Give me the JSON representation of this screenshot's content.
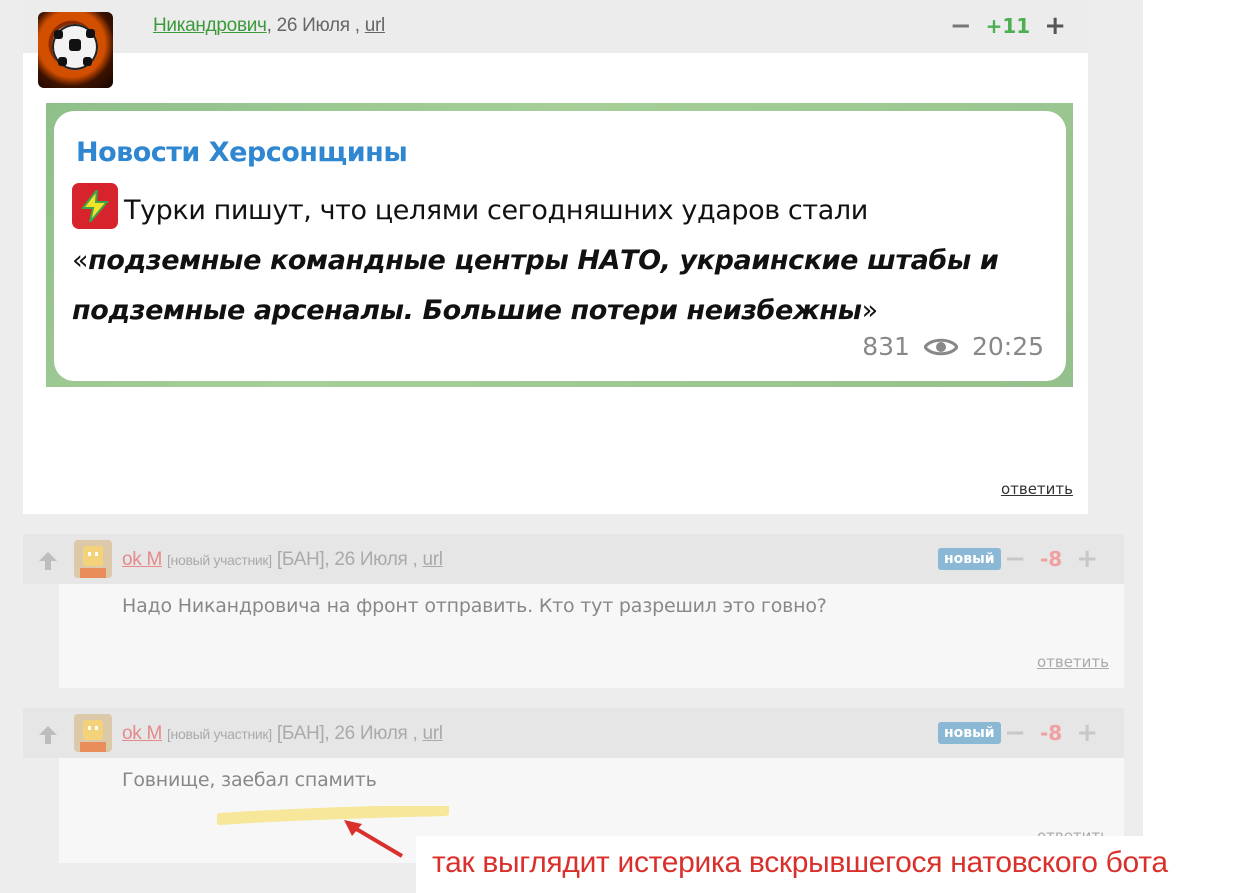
{
  "main_comment": {
    "author": "Никандрович",
    "date": ", 26 Июля ,",
    "link": "url",
    "score": "+11",
    "vote_minus": "−",
    "vote_plus": "+",
    "reply": "ответить",
    "telegram_post": {
      "channel": "Новости Херсонщины",
      "text_plain": "Турки пишут, что целями сегодняшних ударов стали «",
      "text_emphasis": "подземные командные центры НАТО, украинские штабы и подземные арсеналы. Большие потери неизбежны",
      "text_close": "»",
      "views": "831",
      "time": "20:25"
    }
  },
  "replies": [
    {
      "author": "ok M",
      "role": "[новый участник]",
      "ban": "[БАН]",
      "date": ", 26 Июля ,",
      "link": "url",
      "badge": "новый",
      "score": "-8",
      "vote_minus": "−",
      "vote_plus": "+",
      "text": "Надо Никандровича на фронт отправить. Кто тут разрешил это говно?",
      "reply": "ответить"
    },
    {
      "author": "ok M",
      "role": "[новый участник]",
      "ban": "[БАН]",
      "date": ", 26 Июля ,",
      "link": "url",
      "badge": "новый",
      "score": "-8",
      "vote_minus": "−",
      "vote_plus": "+",
      "text": "Говнище, заебал спамить",
      "reply": "ответить"
    }
  ],
  "annotation": {
    "text": "так выглядит истерика вскрывшегося натовского бота",
    "color": "#d9302c"
  },
  "colors": {
    "author_green": "#3c9a3c",
    "score_positive": "#4caf50",
    "score_negative": "#f0a0a0",
    "badge_new": "#8ab8d5",
    "channel_blue": "#2f86d1"
  }
}
